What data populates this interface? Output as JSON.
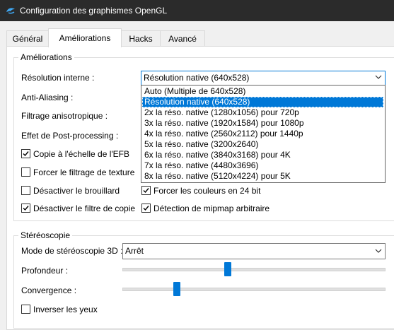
{
  "window": {
    "title": "Configuration des graphismes OpenGL"
  },
  "tabs": [
    {
      "label": "Général"
    },
    {
      "label": "Améliorations"
    },
    {
      "label": "Hacks"
    },
    {
      "label": "Avancé"
    }
  ],
  "ameliorations": {
    "group_title": "Améliorations",
    "resolution_label": "Résolution interne :",
    "resolution_value": "Résolution native (640x528)",
    "resolution_options": [
      "Auto (Multiple de 640x528)",
      "Résolution native (640x528)",
      "2x la réso. native (1280x1056) pour 720p",
      "3x la réso. native (1920x1584) pour 1080p",
      "4x la réso. native (2560x2112) pour 1440p",
      "5x la réso. native (3200x2640)",
      "6x la réso. native (3840x3168) pour 4K",
      "7x la réso. native (4480x3696)",
      "8x la réso. native (5120x4224) pour 5K"
    ],
    "resolution_selected_index": 1,
    "antialiasing_label": "Anti-Aliasing :",
    "anisotropic_label": "Filtrage anisotropique :",
    "postprocessing_label": "Effet de Post-processing :",
    "checkboxes": {
      "copy_efb": {
        "label": "Copie à l'échelle de l'EFB",
        "checked": true
      },
      "force_texture": {
        "label": "Forcer le filtrage de texture",
        "checked": false
      },
      "disable_fog": {
        "label": "Désactiver le brouillard",
        "checked": false
      },
      "force_24bit": {
        "label": "Forcer les couleurs en 24 bit",
        "checked": true
      },
      "disable_copy_filter": {
        "label": "Désactiver le filtre de copie",
        "checked": true
      },
      "mipmap_detection": {
        "label": "Détection de mipmap arbitraire",
        "checked": true
      }
    }
  },
  "stereo": {
    "group_title": "Stéréoscopie",
    "mode_label": "Mode de stéréoscopie 3D :",
    "mode_value": "Arrêt",
    "depth_label": "Profondeur :",
    "depth_level": 0.4,
    "convergence_label": "Convergence :",
    "convergence_level": 0.2,
    "invert_eyes": {
      "label": "Inverser les yeux",
      "checked": false
    }
  },
  "colors": {
    "accent": "#0078d7",
    "titlebar": "#2b2b2b"
  }
}
